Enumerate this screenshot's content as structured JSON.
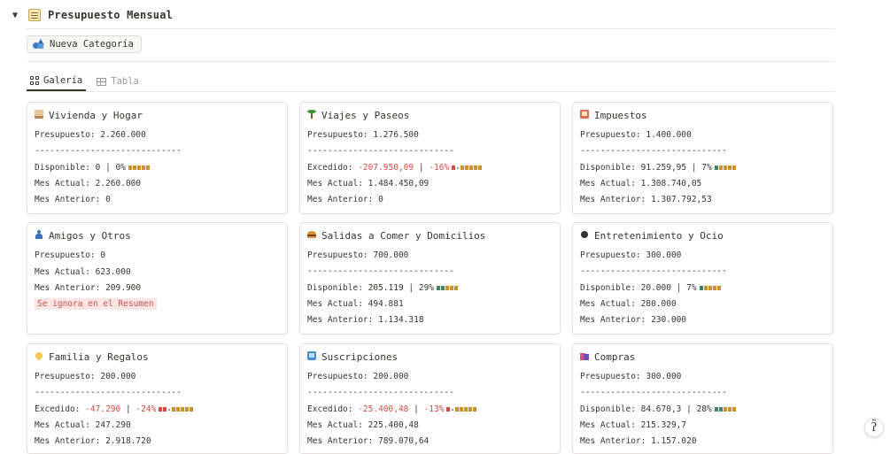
{
  "header": {
    "toggle": "▼",
    "title": "Presupuesto Mensual"
  },
  "button": {
    "label": "Nueva Categoría"
  },
  "tabs": [
    {
      "label": "Galería"
    },
    {
      "label": "Tabla"
    }
  ],
  "sep": "-----------------------------",
  "cards": [
    {
      "title": "Vivienda y Hogar",
      "icon": "house-icon",
      "presupuesto": "Presupuesto: 2.260.000",
      "status_prefix": "Disponible: ",
      "status_amount": "0",
      "status_mid": " | ",
      "status_pct": "0%",
      "status_negative": false,
      "bar": "ooooo",
      "mes_actual": "Mes Actual: 2.260.000",
      "mes_anterior": "Mes Anterior: 0"
    },
    {
      "title": "Viajes y Paseos",
      "icon": "palm-tree-icon",
      "presupuesto": "Presupuesto: 1.276.500",
      "status_prefix": "Excedido: ",
      "status_amount": "-207.950,09",
      "status_mid": " | ",
      "status_pct": "-16%",
      "status_negative": true,
      "bar": "r-ooooo",
      "mes_actual": "Mes Actual: 1.484.450,09",
      "mes_anterior": "Mes Anterior: 0"
    },
    {
      "title": "Impuestos",
      "icon": "ledger-icon",
      "presupuesto": "Presupuesto: 1.400.000",
      "status_prefix": "Disponible: ",
      "status_amount": "91.259,95",
      "status_mid": " | ",
      "status_pct": "7%",
      "status_negative": false,
      "bar": "goooo",
      "mes_actual": "Mes Actual: 1.308.740,05",
      "mes_anterior": "Mes Anterior: 1.307.792,53"
    },
    {
      "title": "Amigos y Otros",
      "icon": "person-icon",
      "presupuesto": "Presupuesto: 0",
      "mes_actual": "Mes Actual: 623.000",
      "mes_anterior": "Mes Anterior: 209.900",
      "note": "Se ignora en el Resumen"
    },
    {
      "title": "Salidas a Comer y Domicilios",
      "icon": "burger-icon",
      "presupuesto": "Presupuesto: 700.000",
      "status_prefix": "Disponible: ",
      "status_amount": "205.119",
      "status_mid": " | ",
      "status_pct": "29%",
      "status_negative": false,
      "bar": "ggooo",
      "mes_actual": "Mes Actual: 494.881",
      "mes_anterior": "Mes Anterior: 1.134.318"
    },
    {
      "title": "Entretenimiento y Ocio",
      "icon": "bowling-icon",
      "presupuesto": "Presupuesto: 300.000",
      "status_prefix": "Disponible: ",
      "status_amount": "20.000",
      "status_mid": " | ",
      "status_pct": "7%",
      "status_negative": false,
      "bar": "goooo",
      "mes_actual": "Mes Actual: 280.000",
      "mes_anterior": "Mes Anterior: 230.000"
    },
    {
      "title": "Familia y Regalos",
      "icon": "heart-icon",
      "presupuesto": "Presupuesto: 200.000",
      "status_prefix": "Excedido: ",
      "status_amount": "-47.290",
      "status_mid": " | ",
      "status_pct": "-24%",
      "status_negative": true,
      "bar": "rr-ooooo",
      "mes_actual": "Mes Actual: 247.290",
      "mes_anterior": "Mes Anterior: 2.918.720"
    },
    {
      "title": "Suscripciones",
      "icon": "tv-icon",
      "presupuesto": "Presupuesto: 200.000",
      "status_prefix": "Excedido: ",
      "status_amount": "-25.400,48",
      "status_mid": " | ",
      "status_pct": "-13%",
      "status_negative": true,
      "bar": "r-ooooo",
      "mes_actual": "Mes Actual: 225.400,48",
      "mes_anterior": "Mes Anterior: 789.070,64"
    },
    {
      "title": "Compras",
      "icon": "shopping-bags-icon",
      "presupuesto": "Presupuesto: 300.000",
      "status_prefix": "Disponible: ",
      "status_amount": "84.670,3",
      "status_mid": " | ",
      "status_pct": "28%",
      "status_negative": false,
      "bar": "ggooo",
      "mes_actual": "Mes Actual: 215.329,7",
      "mes_anterior": "Mes Anterior: 1.157.020"
    }
  ],
  "help_glyph": "ʔ̃"
}
